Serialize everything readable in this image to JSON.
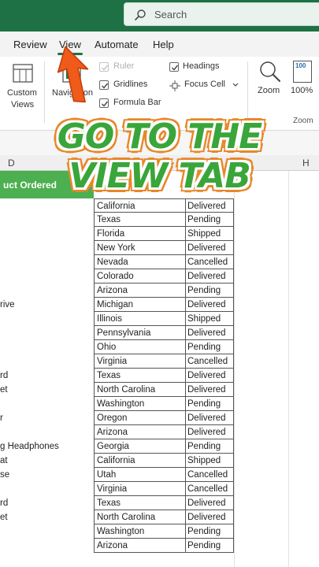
{
  "search": {
    "placeholder": "Search"
  },
  "tabs": [
    {
      "label": "Review"
    },
    {
      "label": "View"
    },
    {
      "label": "Automate"
    },
    {
      "label": "Help"
    }
  ],
  "ribbon": {
    "custom_views_line1": "Custom",
    "custom_views_line2": "Views",
    "navigation": "Navigation",
    "ruler": "Ruler",
    "gridlines": "Gridlines",
    "formula_bar": "Formula Bar",
    "headings": "Headings",
    "focus_cell": "Focus Cell",
    "zoom": "Zoom",
    "zoom_100": "100%",
    "zoom_icon_text": "100",
    "zoom_group_label": "Zoom"
  },
  "columns": {
    "D": "D",
    "H": "H"
  },
  "header_cell": "uct Ordered",
  "overlay": {
    "line1": "GO TO THE",
    "line2": "VIEW TAB"
  },
  "rows": [
    {
      "d": "",
      "state": "California",
      "status": "Delivered"
    },
    {
      "d": "",
      "state": "Texas",
      "status": "Pending"
    },
    {
      "d": "",
      "state": "Florida",
      "status": "Shipped"
    },
    {
      "d": "",
      "state": "New York",
      "status": "Delivered"
    },
    {
      "d": "",
      "state": "Nevada",
      "status": "Cancelled"
    },
    {
      "d": "",
      "state": "Colorado",
      "status": "Delivered"
    },
    {
      "d": "",
      "state": "Arizona",
      "status": "Pending"
    },
    {
      "d": "rive",
      "state": "Michigan",
      "status": "Delivered"
    },
    {
      "d": "",
      "state": "Illinois",
      "status": "Shipped"
    },
    {
      "d": "",
      "state": "Pennsylvania",
      "status": "Delivered"
    },
    {
      "d": "",
      "state": "Ohio",
      "status": "Pending"
    },
    {
      "d": "",
      "state": "Virginia",
      "status": "Cancelled"
    },
    {
      "d": "rd",
      "state": "Texas",
      "status": "Delivered"
    },
    {
      "d": "et",
      "state": "North Carolina",
      "status": "Delivered"
    },
    {
      "d": "",
      "state": "Washington",
      "status": "Pending"
    },
    {
      "d": "r",
      "state": "Oregon",
      "status": "Delivered"
    },
    {
      "d": "",
      "state": "Arizona",
      "status": "Delivered"
    },
    {
      "d": "g Headphones",
      "state": "Georgia",
      "status": "Pending"
    },
    {
      "d": "at",
      "state": "California",
      "status": "Shipped"
    },
    {
      "d": "se",
      "state": "Utah",
      "status": "Cancelled"
    },
    {
      "d": "",
      "state": "Virginia",
      "status": "Cancelled"
    },
    {
      "d": "rd",
      "state": "Texas",
      "status": "Delivered"
    },
    {
      "d": "et",
      "state": "North Carolina",
      "status": "Delivered"
    },
    {
      "d": "",
      "state": "Washington",
      "status": "Pending"
    },
    {
      "d": "",
      "state": "Arizona",
      "status": "Pending"
    }
  ],
  "colors": {
    "excel_green": "#1e7145",
    "header_green": "#4caf50",
    "overlay_green": "#3aa53a",
    "overlay_orange": "#e8872a",
    "arrow_orange": "#f05a1a"
  }
}
